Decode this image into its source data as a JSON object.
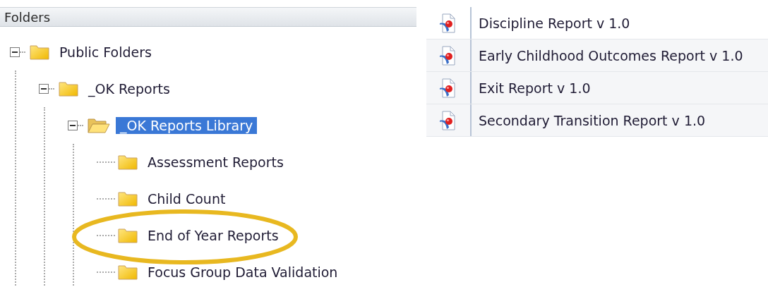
{
  "folders_panel": {
    "title": "Folders",
    "tree": [
      {
        "label": "Public Folders",
        "expanded": true,
        "selected": false,
        "children": [
          {
            "label": "_OK Reports",
            "expanded": true,
            "selected": false,
            "children": [
              {
                "label": "_OK Reports Library",
                "expanded": true,
                "selected": true,
                "children": [
                  {
                    "label": "Assessment Reports",
                    "selected": false,
                    "circled": false
                  },
                  {
                    "label": "Child Count",
                    "selected": false,
                    "circled": false
                  },
                  {
                    "label": "End of Year Reports",
                    "selected": false,
                    "circled": true
                  },
                  {
                    "label": "Focus Group Data Validation",
                    "selected": false,
                    "circled": false
                  }
                ]
              }
            ]
          }
        ]
      }
    ]
  },
  "reports": [
    {
      "name": "Discipline Report v 1.0"
    },
    {
      "name": "Early Childhood Outcomes Report v 1.0"
    },
    {
      "name": "Exit Report v 1.0"
    },
    {
      "name": "Secondary Transition Report v 1.0"
    }
  ]
}
